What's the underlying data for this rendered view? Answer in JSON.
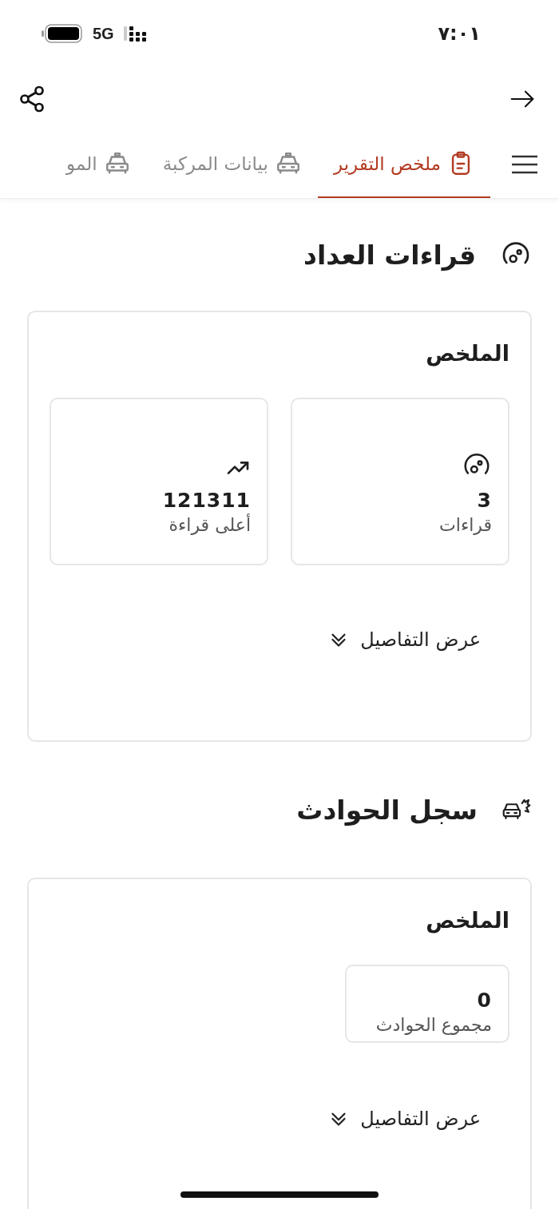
{
  "status_bar": {
    "time": "٧:٠١",
    "network": "5G"
  },
  "tabs": [
    {
      "label": "ملخص التقرير",
      "selected": true
    },
    {
      "label": "بيانات المركبة",
      "selected": false
    },
    {
      "label": "المو",
      "selected": false
    }
  ],
  "sections": [
    {
      "kind": "odometer",
      "title": "قراءات العداد",
      "summary_title": "الملخص",
      "stats": [
        {
          "kind": "count",
          "value": "3",
          "label": "قراءات"
        },
        {
          "kind": "peak",
          "value": "121311",
          "label": "أعلى قراءة"
        }
      ],
      "details_link": "عرض التفاصيل"
    },
    {
      "kind": "accidents",
      "title": "سجل الحوادث",
      "summary_title": "الملخص",
      "stats": [
        {
          "kind": "total",
          "value": "0",
          "label": "مجموع الحوادث"
        }
      ],
      "details_link": "عرض التفاصيل"
    }
  ]
}
